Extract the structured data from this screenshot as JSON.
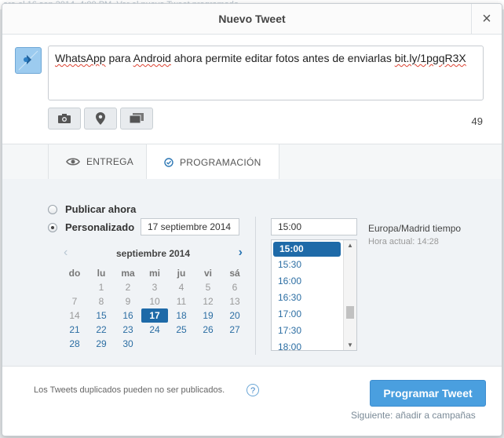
{
  "background_strip": "ara el 16 sep 2014, 4:00 PM. Ver el nuevo Tweet programado",
  "modal": {
    "title": "Nuevo Tweet",
    "close_label": "×"
  },
  "composer": {
    "text_parts": [
      "WhatsApp",
      " para ",
      "Android",
      " ahora permite editar fotos antes de enviarlas ",
      "bit.ly/1pgqR3X"
    ],
    "char_count": "49",
    "tools": [
      "camera-icon",
      "location-pin-icon",
      "media-gallery-icon"
    ]
  },
  "tabs": [
    {
      "label": "ENTREGA",
      "icon": "eye-icon"
    },
    {
      "label": "PROGRAMACIÓN",
      "icon": "clock-check-icon",
      "active": true
    }
  ],
  "schedule": {
    "option_now": "Publicar ahora",
    "option_custom": "Personalizado",
    "selected_option": "custom",
    "date_value": "17 septiembre 2014",
    "calendar": {
      "month_label": "septiembre 2014",
      "weekdays": [
        "do",
        "lu",
        "ma",
        "mi",
        "ju",
        "vi",
        "sá"
      ],
      "weeks": [
        [
          "",
          "1",
          "2",
          "3",
          "4",
          "5",
          "6"
        ],
        [
          "7",
          "8",
          "9",
          "10",
          "11",
          "12",
          "13"
        ],
        [
          "14",
          "15",
          "16",
          "17",
          "18",
          "19",
          "20"
        ],
        [
          "21",
          "22",
          "23",
          "24",
          "25",
          "26",
          "27"
        ],
        [
          "28",
          "29",
          "30",
          "",
          "",
          "",
          ""
        ]
      ],
      "selected_day": "17",
      "past_days": [
        "1",
        "2",
        "3",
        "4",
        "5",
        "6",
        "7",
        "8",
        "9",
        "10",
        "11",
        "12",
        "13",
        "14"
      ]
    },
    "time_value": "15:00",
    "time_options": [
      "15:00",
      "15:30",
      "16:00",
      "16:30",
      "17:00",
      "17:30",
      "18:00"
    ],
    "selected_time": "15:00",
    "timezone_label": "Europa/Madrid tiempo",
    "current_time_label": "Hora actual: 14:28"
  },
  "footer": {
    "note": "Los Tweets duplicados pueden no ser publicados.",
    "help_label": "?",
    "primary_button": "Programar Tweet",
    "secondary_link": "Siguiente: añadir a campañas"
  }
}
